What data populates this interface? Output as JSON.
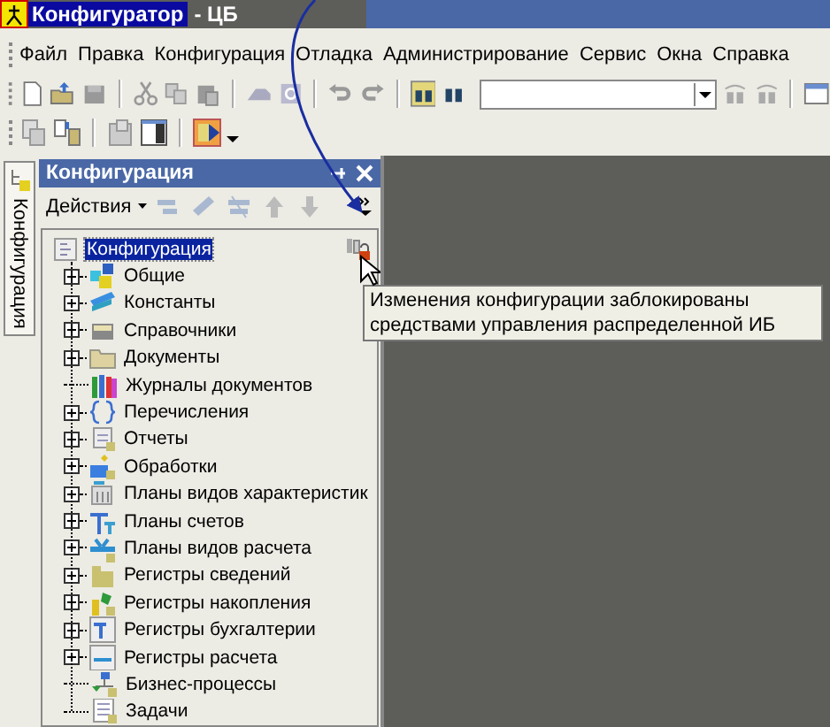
{
  "window": {
    "title": "Конфигуратор",
    "subtitle": "- ЦБ"
  },
  "menu": [
    {
      "label": "Файл"
    },
    {
      "label": "Правка"
    },
    {
      "label": "Конфигурация"
    },
    {
      "label": "Отладка"
    },
    {
      "label": "Администрирование"
    },
    {
      "label": "Сервис"
    },
    {
      "label": "Окна"
    },
    {
      "label": "Справка"
    }
  ],
  "side_tab": {
    "label": "Конфигурация",
    "selected": true
  },
  "panel": {
    "title": "Конфигурация",
    "actions": "Действия"
  },
  "tree": {
    "label": "Конфигурация",
    "selected": true,
    "locked": true,
    "children": [
      {
        "label": "Общие",
        "expandable": true
      },
      {
        "label": "Константы",
        "expandable": true
      },
      {
        "label": "Справочники",
        "expandable": true
      },
      {
        "label": "Документы",
        "expandable": true
      },
      {
        "label": "Журналы документов",
        "expandable": false
      },
      {
        "label": "Перечисления",
        "expandable": true
      },
      {
        "label": "Отчеты",
        "expandable": true
      },
      {
        "label": "Обработки",
        "expandable": true
      },
      {
        "label": "Планы видов характеристик",
        "expandable": true
      },
      {
        "label": "Планы счетов",
        "expandable": true
      },
      {
        "label": "Планы видов расчета",
        "expandable": true
      },
      {
        "label": "Регистры сведений",
        "expandable": true
      },
      {
        "label": "Регистры накопления",
        "expandable": true
      },
      {
        "label": "Регистры бухгалтерии",
        "expandable": true
      },
      {
        "label": "Регистры расчета",
        "expandable": true
      },
      {
        "label": "Бизнес-процессы",
        "expandable": false
      },
      {
        "label": "Задачи",
        "expandable": false
      }
    ]
  },
  "tooltip": {
    "text": "Изменения конфигурации заблокированы средствами управления распределенной ИБ"
  }
}
